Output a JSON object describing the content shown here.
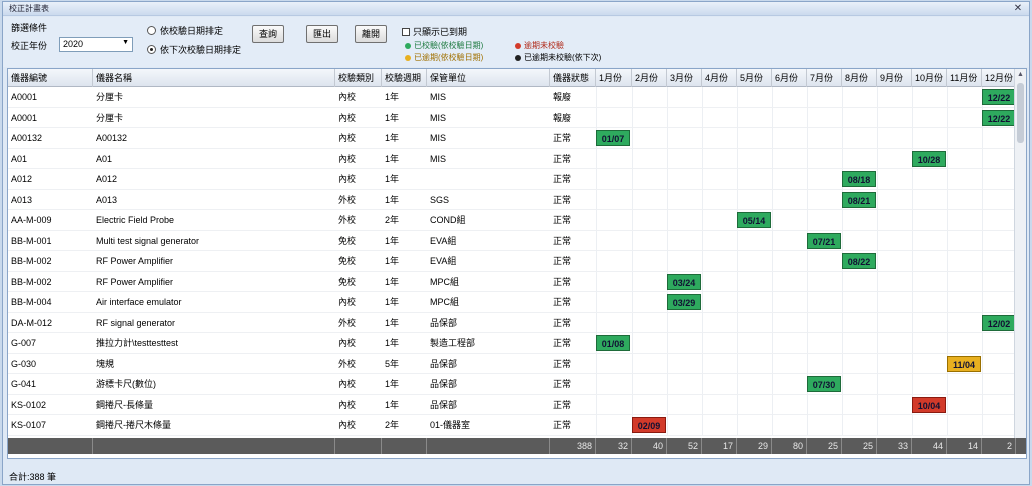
{
  "window": {
    "title": "校正計畫表"
  },
  "filter": {
    "group_label": "篩選條件",
    "year_label": "校正年份",
    "year_value": "2020",
    "radio1": "依校驗日期排定",
    "radio2": "依下次校驗日期排定",
    "btn_query": "查詢",
    "btn_export": "匯出",
    "btn_close": "離開",
    "check_label": "只顯示已到期",
    "legend": {
      "green": "已校驗(依校驗日期)",
      "yellow": "已逾期(依校驗日期)",
      "red": "逾期未校驗",
      "dark": "已逾期未校驗(依下次)"
    },
    "colors": {
      "green": "#2eaa5e",
      "yellow": "#e8b020",
      "red": "#d23a2a",
      "dark": "#222222"
    }
  },
  "columns": [
    "儀器編號",
    "儀器名稱",
    "校驗類別",
    "校驗週期",
    "保管單位",
    "儀器狀態",
    "1月份",
    "2月份",
    "3月份",
    "4月份",
    "5月份",
    "6月份",
    "7月份",
    "8月份",
    "9月份",
    "10月份",
    "11月份",
    "12月份"
  ],
  "rows": [
    {
      "id": "A0001",
      "name": "分厘卡",
      "type": "內校",
      "cycle": "1年",
      "unit": "MIS",
      "status": "報廢",
      "month": 12,
      "date": "12/22",
      "color": "green"
    },
    {
      "id": "A0001",
      "name": "分厘卡",
      "type": "內校",
      "cycle": "1年",
      "unit": "MIS",
      "status": "報廢",
      "month": 12,
      "date": "12/22",
      "color": "green"
    },
    {
      "id": "A00132",
      "name": "A00132",
      "type": "內校",
      "cycle": "1年",
      "unit": "MIS",
      "status": "正常",
      "month": 1,
      "date": "01/07",
      "color": "green"
    },
    {
      "id": "A01",
      "name": "A01",
      "type": "內校",
      "cycle": "1年",
      "unit": "MIS",
      "status": "正常",
      "month": 10,
      "date": "10/28",
      "color": "green"
    },
    {
      "id": "A012",
      "name": "A012",
      "type": "內校",
      "cycle": "1年",
      "unit": "",
      "status": "正常",
      "month": 8,
      "date": "08/18",
      "color": "green"
    },
    {
      "id": "A013",
      "name": "A013",
      "type": "外校",
      "cycle": "1年",
      "unit": "SGS",
      "status": "正常",
      "month": 8,
      "date": "08/21",
      "color": "green"
    },
    {
      "id": "AA-M-009",
      "name": "Electric Field Probe",
      "type": "外校",
      "cycle": "2年",
      "unit": "COND組",
      "status": "正常",
      "month": 5,
      "date": "05/14",
      "color": "green"
    },
    {
      "id": "BB-M-001",
      "name": "Multi test signal generator",
      "type": "免校",
      "cycle": "1年",
      "unit": "EVA組",
      "status": "正常",
      "month": 7,
      "date": "07/21",
      "color": "green"
    },
    {
      "id": "BB-M-002",
      "name": "RF Power Amplifier",
      "type": "免校",
      "cycle": "1年",
      "unit": "EVA組",
      "status": "正常",
      "month": 8,
      "date": "08/22",
      "color": "green"
    },
    {
      "id": "BB-M-002",
      "name": "RF Power Amplifier",
      "type": "免校",
      "cycle": "1年",
      "unit": "MPC組",
      "status": "正常",
      "month": 3,
      "date": "03/24",
      "color": "green"
    },
    {
      "id": "BB-M-004",
      "name": "Air interface emulator",
      "type": "內校",
      "cycle": "1年",
      "unit": "MPC組",
      "status": "正常",
      "month": 3,
      "date": "03/29",
      "color": "green"
    },
    {
      "id": "DA-M-012",
      "name": "RF signal generator",
      "type": "外校",
      "cycle": "1年",
      "unit": "品保部",
      "status": "正常",
      "month": 12,
      "date": "12/02",
      "color": "green"
    },
    {
      "id": "G-007",
      "name": "推拉力計\\testtesttest",
      "type": "內校",
      "cycle": "1年",
      "unit": "製造工程部",
      "status": "正常",
      "month": 1,
      "date": "01/08",
      "color": "green"
    },
    {
      "id": "G-030",
      "name": "塊規",
      "type": "外校",
      "cycle": "5年",
      "unit": "品保部",
      "status": "正常",
      "month": 11,
      "date": "11/04",
      "color": "yellow"
    },
    {
      "id": "G-041",
      "name": "游標卡尺(數位)",
      "type": "內校",
      "cycle": "1年",
      "unit": "品保部",
      "status": "正常",
      "month": 7,
      "date": "07/30",
      "color": "green"
    },
    {
      "id": "KS-0102",
      "name": "鋼捲尺-長條量",
      "type": "內校",
      "cycle": "1年",
      "unit": "品保部",
      "status": "正常",
      "month": 10,
      "date": "10/04",
      "color": "red"
    },
    {
      "id": "KS-0107",
      "name": "鋼捲尺-捲尺木條量",
      "type": "內校",
      "cycle": "2年",
      "unit": "01-儀器室",
      "status": "正常",
      "month": 2,
      "date": "02/09",
      "color": "red"
    }
  ],
  "totals": {
    "total": "388",
    "months": [
      "32",
      "40",
      "52",
      "17",
      "29",
      "80",
      "25",
      "25",
      "33",
      "44",
      "14",
      "2"
    ]
  },
  "status_bar": "合計:388 筆"
}
